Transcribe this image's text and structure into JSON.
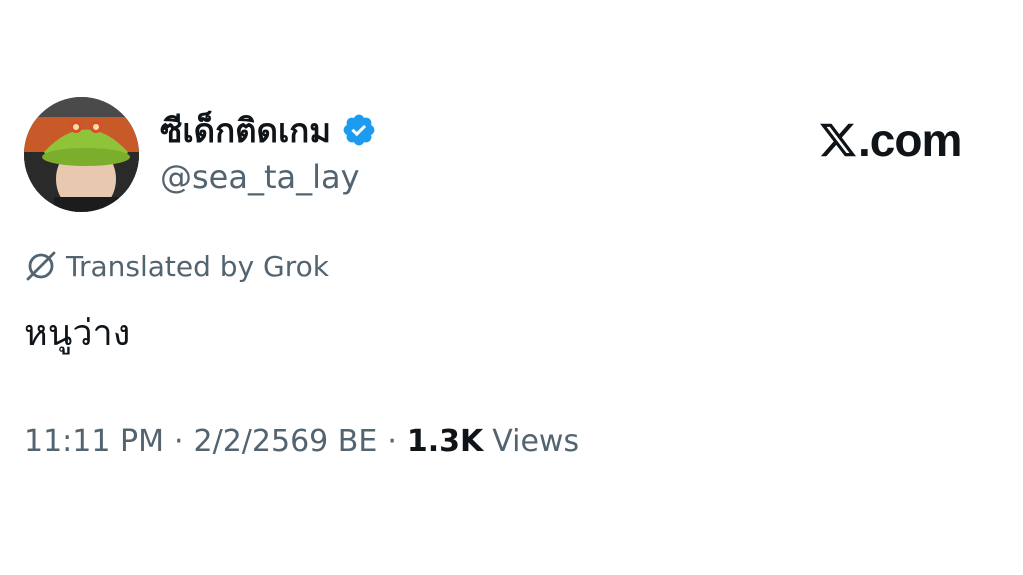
{
  "author": {
    "display_name": "ซีเด็กติดเกม",
    "handle": "@sea_ta_lay",
    "verified": true,
    "verified_color": "#1d9bf0"
  },
  "brand": {
    "text": ".com",
    "logo": "x-logo-icon"
  },
  "translation": {
    "label": "Translated by Grok",
    "icon": "grok-icon"
  },
  "tweet": {
    "text": "หนูว่าง"
  },
  "meta": {
    "time": "11:11 PM",
    "separator": "·",
    "date": "2/2/2569 BE",
    "views_count": "1.3K",
    "views_label": "Views"
  }
}
